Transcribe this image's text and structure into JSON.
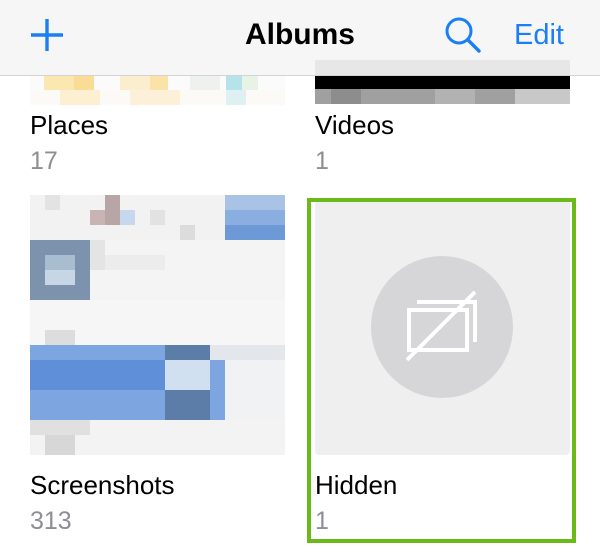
{
  "nav": {
    "title": "Albums",
    "edit_label": "Edit",
    "add_icon": "plus-icon",
    "search_icon": "magnifier-icon",
    "accent_color": "#1a7ff7"
  },
  "albums": [
    {
      "name": "Places",
      "count": "17"
    },
    {
      "name": "Videos",
      "count": "1"
    },
    {
      "name": "Screenshots",
      "count": "313"
    },
    {
      "name": "Hidden",
      "count": "1",
      "thumbnail_icon": "hidden-photo-icon",
      "highlight_color": "#6cba1a"
    }
  ]
}
